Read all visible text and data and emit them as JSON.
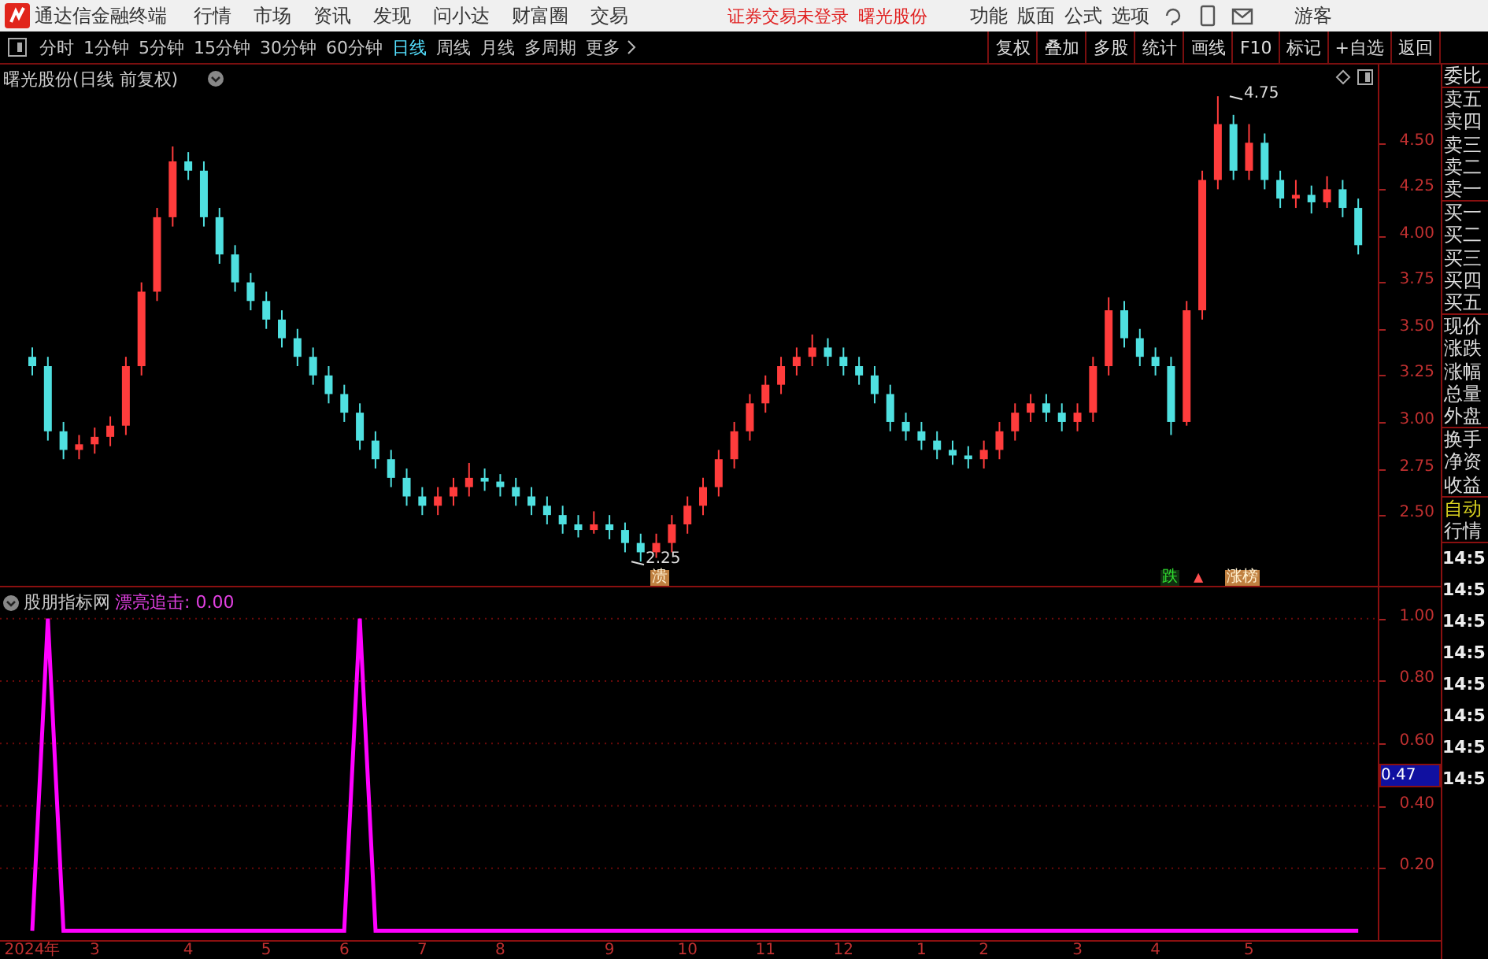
{
  "menu_bar": {
    "app_title": "通达信金融终端",
    "menus": [
      "行情",
      "市场",
      "资讯",
      "发现",
      "问小达",
      "财富圈",
      "交易"
    ],
    "login_status": "证券交易未登录",
    "stock_name": "曙光股份",
    "right_menus": [
      "功能",
      "版面",
      "公式",
      "选项"
    ],
    "user": "游客"
  },
  "toolbar": {
    "periods": [
      {
        "label": "分时",
        "selected": false
      },
      {
        "label": "1分钟",
        "selected": false
      },
      {
        "label": "5分钟",
        "selected": false
      },
      {
        "label": "15分钟",
        "selected": false
      },
      {
        "label": "30分钟",
        "selected": false
      },
      {
        "label": "60分钟",
        "selected": false
      },
      {
        "label": "日线",
        "selected": true
      },
      {
        "label": "周线",
        "selected": false
      },
      {
        "label": "月线",
        "selected": false
      },
      {
        "label": "多周期",
        "selected": false
      }
    ],
    "more": "更多",
    "buttons": [
      "复权",
      "叠加",
      "多股",
      "统计",
      "画线",
      "F10",
      "标记",
      "+自选",
      "返回"
    ]
  },
  "main_chart": {
    "title": "曙光股份(日线 前复权)",
    "high_marker": "4.75",
    "low_marker": "2.25",
    "chart_data": {
      "type": "candlestick",
      "ylim": [
        2.12,
        4.92
      ],
      "yticks": [
        {
          "value": 4.5,
          "label": "4.50"
        },
        {
          "value": 4.25,
          "label": "4.25"
        },
        {
          "value": 4,
          "label": "4.00"
        },
        {
          "value": 3.75,
          "label": "3.75"
        },
        {
          "value": 3.5,
          "label": "3.50"
        },
        {
          "value": 3.25,
          "label": "3.25"
        },
        {
          "value": 3,
          "label": "3.00"
        },
        {
          "value": 2.75,
          "label": "2.75"
        },
        {
          "value": 2.5,
          "label": "2.50"
        }
      ],
      "categories": [
        null,
        null,
        null,
        null,
        null,
        null,
        null,
        null,
        null,
        null,
        null,
        null,
        null,
        null,
        null,
        null,
        null,
        null,
        null,
        null,
        null,
        null,
        null,
        null,
        null,
        null,
        null,
        null,
        null,
        null,
        null,
        null,
        null,
        null,
        null,
        null,
        null,
        null,
        null,
        null,
        null,
        null,
        null,
        null,
        null,
        null,
        null,
        null,
        null,
        null,
        null,
        null,
        null,
        null,
        null,
        null,
        null,
        null,
        null,
        null,
        null,
        null,
        null,
        null,
        null,
        null,
        null,
        null,
        null,
        null,
        null,
        null,
        null,
        null,
        null,
        null,
        null,
        null,
        null,
        null,
        null,
        null,
        null,
        null,
        null,
        null
      ],
      "ohlc": [
        [
          3.35,
          3.4,
          3.25,
          3.3
        ],
        [
          3.3,
          3.35,
          2.9,
          2.95
        ],
        [
          2.95,
          3.0,
          2.8,
          2.85
        ],
        [
          2.85,
          2.93,
          2.8,
          2.88
        ],
        [
          2.88,
          2.97,
          2.83,
          2.92
        ],
        [
          2.92,
          3.03,
          2.87,
          2.98
        ],
        [
          2.98,
          3.35,
          2.93,
          3.3
        ],
        [
          3.3,
          3.75,
          3.25,
          3.7
        ],
        [
          3.7,
          4.15,
          3.65,
          4.1
        ],
        [
          4.1,
          4.48,
          4.05,
          4.4
        ],
        [
          4.4,
          4.45,
          4.3,
          4.35
        ],
        [
          4.35,
          4.4,
          4.05,
          4.1
        ],
        [
          4.1,
          4.15,
          3.85,
          3.9
        ],
        [
          3.9,
          3.95,
          3.7,
          3.75
        ],
        [
          3.75,
          3.8,
          3.6,
          3.65
        ],
        [
          3.65,
          3.7,
          3.5,
          3.55
        ],
        [
          3.55,
          3.6,
          3.4,
          3.45
        ],
        [
          3.45,
          3.5,
          3.3,
          3.35
        ],
        [
          3.35,
          3.4,
          3.2,
          3.25
        ],
        [
          3.25,
          3.3,
          3.1,
          3.15
        ],
        [
          3.15,
          3.2,
          3.0,
          3.05
        ],
        [
          3.05,
          3.1,
          2.85,
          2.9
        ],
        [
          2.9,
          2.95,
          2.75,
          2.8
        ],
        [
          2.8,
          2.85,
          2.65,
          2.7
        ],
        [
          2.7,
          2.75,
          2.55,
          2.6
        ],
        [
          2.6,
          2.65,
          2.5,
          2.55
        ],
        [
          2.55,
          2.65,
          2.5,
          2.6
        ],
        [
          2.6,
          2.7,
          2.55,
          2.65
        ],
        [
          2.65,
          2.78,
          2.6,
          2.7
        ],
        [
          2.7,
          2.75,
          2.63,
          2.68
        ],
        [
          2.68,
          2.72,
          2.6,
          2.65
        ],
        [
          2.65,
          2.7,
          2.55,
          2.6
        ],
        [
          2.6,
          2.65,
          2.5,
          2.55
        ],
        [
          2.55,
          2.6,
          2.45,
          2.5
        ],
        [
          2.5,
          2.55,
          2.4,
          2.45
        ],
        [
          2.45,
          2.5,
          2.38,
          2.42
        ],
        [
          2.42,
          2.52,
          2.4,
          2.45
        ],
        [
          2.45,
          2.5,
          2.37,
          2.42
        ],
        [
          2.42,
          2.46,
          2.3,
          2.35
        ],
        [
          2.35,
          2.4,
          2.25,
          2.3
        ],
        [
          2.3,
          2.4,
          2.27,
          2.35
        ],
        [
          2.35,
          2.5,
          2.3,
          2.45
        ],
        [
          2.45,
          2.6,
          2.4,
          2.55
        ],
        [
          2.55,
          2.7,
          2.5,
          2.65
        ],
        [
          2.65,
          2.85,
          2.6,
          2.8
        ],
        [
          2.8,
          3.0,
          2.75,
          2.95
        ],
        [
          2.95,
          3.15,
          2.9,
          3.1
        ],
        [
          3.1,
          3.25,
          3.05,
          3.2
        ],
        [
          3.2,
          3.35,
          3.15,
          3.3
        ],
        [
          3.3,
          3.4,
          3.25,
          3.35
        ],
        [
          3.35,
          3.47,
          3.3,
          3.4
        ],
        [
          3.4,
          3.45,
          3.3,
          3.35
        ],
        [
          3.35,
          3.4,
          3.25,
          3.3
        ],
        [
          3.3,
          3.35,
          3.2,
          3.25
        ],
        [
          3.25,
          3.3,
          3.1,
          3.15
        ],
        [
          3.15,
          3.2,
          2.95,
          3.0
        ],
        [
          3.0,
          3.05,
          2.9,
          2.95
        ],
        [
          2.95,
          3.0,
          2.85,
          2.9
        ],
        [
          2.9,
          2.95,
          2.8,
          2.85
        ],
        [
          2.85,
          2.9,
          2.77,
          2.82
        ],
        [
          2.82,
          2.87,
          2.75,
          2.8
        ],
        [
          2.8,
          2.9,
          2.75,
          2.85
        ],
        [
          2.85,
          3.0,
          2.8,
          2.95
        ],
        [
          2.95,
          3.1,
          2.9,
          3.05
        ],
        [
          3.05,
          3.15,
          3.0,
          3.1
        ],
        [
          3.1,
          3.15,
          3.0,
          3.05
        ],
        [
          3.05,
          3.1,
          2.95,
          3.0
        ],
        [
          3.0,
          3.1,
          2.95,
          3.05
        ],
        [
          3.05,
          3.35,
          3.0,
          3.3
        ],
        [
          3.3,
          3.67,
          3.25,
          3.6
        ],
        [
          3.6,
          3.65,
          3.4,
          3.45
        ],
        [
          3.45,
          3.5,
          3.3,
          3.35
        ],
        [
          3.35,
          3.4,
          3.25,
          3.3
        ],
        [
          3.3,
          3.35,
          2.93,
          3.0
        ],
        [
          3.0,
          3.65,
          2.98,
          3.6
        ],
        [
          3.6,
          4.35,
          3.55,
          4.3
        ],
        [
          4.3,
          4.75,
          4.25,
          4.6
        ],
        [
          4.6,
          4.65,
          4.3,
          4.35
        ],
        [
          4.35,
          4.6,
          4.3,
          4.5
        ],
        [
          4.5,
          4.55,
          4.25,
          4.3
        ],
        [
          4.3,
          4.35,
          4.15,
          4.2
        ],
        [
          4.2,
          4.3,
          4.15,
          4.22
        ],
        [
          4.22,
          4.27,
          4.12,
          4.18
        ],
        [
          4.18,
          4.32,
          4.15,
          4.25
        ],
        [
          4.25,
          4.3,
          4.1,
          4.15
        ],
        [
          4.15,
          4.2,
          3.9,
          3.95
        ]
      ]
    },
    "signals": [
      {
        "label": "溃",
        "kind": "tag"
      },
      {
        "label": "跌",
        "kind": "fall"
      },
      {
        "label": "▲",
        "kind": "arrow"
      },
      {
        "label": "涨榜",
        "kind": "tag"
      }
    ]
  },
  "indicator": {
    "name": "股朋指标网",
    "reading": "漂亮追击: 0.00",
    "cursor_value": "0.47",
    "chart_data": {
      "type": "line",
      "ylim": [
        -0.03,
        1.1
      ],
      "grid": true,
      "yticks": [
        {
          "value": 1,
          "label": "1.00"
        },
        {
          "value": 0.8,
          "label": "0.80"
        },
        {
          "value": 0.6,
          "label": "0.60"
        },
        {
          "value": 0.4,
          "label": "0.40"
        },
        {
          "value": 0.2,
          "label": "0.20"
        }
      ],
      "categories": [
        "2024年",
        null,
        null,
        null,
        "3",
        null,
        null,
        null,
        null,
        null,
        "4",
        null,
        null,
        null,
        null,
        "5",
        null,
        null,
        null,
        null,
        "6",
        null,
        null,
        null,
        null,
        "7",
        null,
        null,
        null,
        null,
        "8",
        null,
        null,
        null,
        null,
        null,
        null,
        "9",
        null,
        null,
        null,
        null,
        "10",
        null,
        null,
        null,
        null,
        "11",
        null,
        null,
        null,
        null,
        "12",
        null,
        null,
        null,
        null,
        "1",
        null,
        null,
        null,
        "2",
        null,
        null,
        null,
        null,
        null,
        "3",
        null,
        null,
        null,
        null,
        "4",
        null,
        null,
        null,
        null,
        null,
        "5",
        null,
        null,
        null,
        null,
        null,
        null,
        null
      ],
      "series": [
        {
          "color": "#ff00ff",
          "values": [
            0,
            1,
            0,
            0,
            0,
            0,
            0,
            0,
            0,
            0,
            0,
            0,
            0,
            0,
            0,
            0,
            0,
            0,
            0,
            0,
            0,
            1,
            0,
            0,
            0,
            0,
            0,
            0,
            0,
            0,
            0,
            0,
            0,
            0,
            0,
            0,
            0,
            0,
            0,
            0,
            0,
            0,
            0,
            0,
            0,
            0,
            0,
            0,
            0,
            0,
            0,
            0,
            0,
            0,
            0,
            0,
            0,
            0,
            0,
            0,
            0,
            0,
            0,
            0,
            0,
            0,
            0,
            0,
            0,
            0,
            0,
            0,
            0,
            0,
            0,
            0,
            0,
            0,
            0,
            0,
            0,
            0,
            0,
            0,
            0,
            0
          ]
        }
      ]
    }
  },
  "quote_panel": {
    "groups": [
      [
        "委比"
      ],
      [
        "卖五",
        "卖四",
        "卖三",
        "卖二",
        "卖一"
      ],
      [
        "买一",
        "买二",
        "买三",
        "买四",
        "买五"
      ],
      [
        "现价",
        "涨跌",
        "涨幅",
        "总量",
        "外盘"
      ],
      [
        "换手",
        "净资",
        "收益"
      ]
    ],
    "auto": "自动",
    "quote": "行情",
    "times": [
      "14:5",
      "14:5",
      "14:5",
      "14:5",
      "14:5",
      "14:5",
      "14:5",
      "14:5"
    ]
  }
}
